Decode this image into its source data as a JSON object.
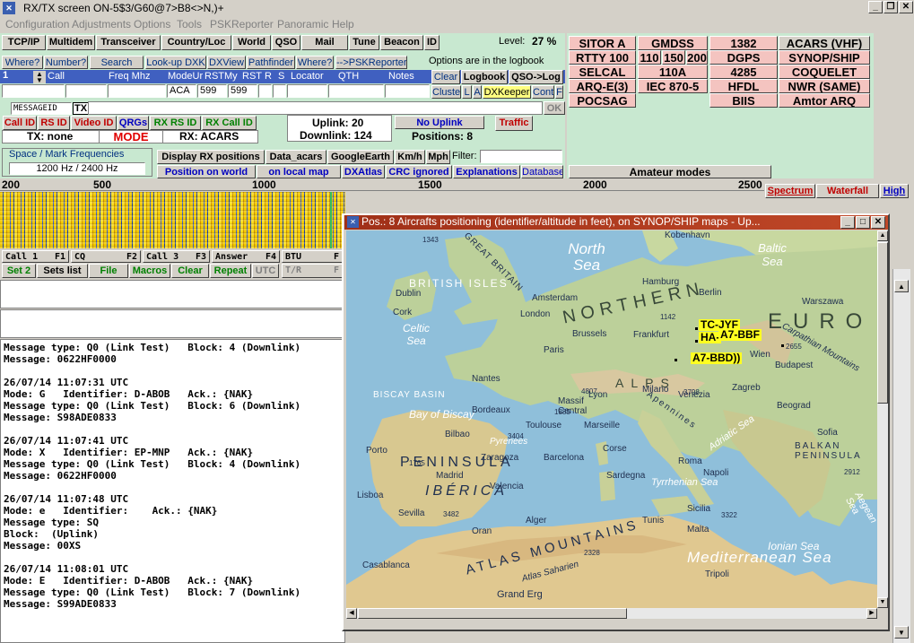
{
  "window": {
    "title": "RX/TX screen  ON-5$3/G60@7>B8<>N,)+"
  },
  "menu": [
    "Configuration",
    "Adjustments",
    "Options",
    "Tools",
    "PSKReporter",
    "Panoramic",
    "Help"
  ],
  "toolbar": {
    "tcpip": "TCP/IP",
    "multidem": "Multidem",
    "transceiver": "Transceiver",
    "country": "Country/Loc",
    "world": "World",
    "qso": "QSO",
    "mail": "Mail",
    "tune": "Tune",
    "beacon": "Beacon",
    "id": "ID",
    "level_label": "Level:",
    "level_value": "27 %"
  },
  "row2": {
    "where1": "Where?",
    "number": "Number?",
    "search": "Search",
    "lookup": "Look-up DXK",
    "dxview": "DXView",
    "pathfinder": "Pathfinder",
    "where2": "Where?",
    "pskrep": "-->PSKReporter",
    "logbook_note": "Options are in the logbook"
  },
  "log_headers": {
    "call": "Call",
    "freq": "Freq Mhz",
    "mode": "ModeUr",
    "rst": "RSTMy",
    "rst2": "RST",
    "r": "R",
    "s": "S",
    "locator": "Locator",
    "qth": "QTH",
    "notes": "Notes"
  },
  "log_row": {
    "num": "1",
    "mode": "ACA",
    "rst": "599",
    "rst2": "599"
  },
  "log_buttons": {
    "clear": "Clear",
    "logbook": "Logbook",
    "qsolog": "QSO->Log",
    "cluster": "Cluster",
    "l": "L",
    "a": "A",
    "dxkeeper": "DXKeeper",
    "cont": "Cont",
    "f": "F"
  },
  "msgid": "MESSAGEID",
  "tx_badge": "TX",
  "ok": "OK",
  "idbar": {
    "call_id": "Call ID",
    "rs_id": "RS ID",
    "video_id": "Video ID",
    "qrgs": "QRGs",
    "rx_rs_id": "RX RS ID",
    "rx_call_id": "RX Call ID"
  },
  "status": {
    "tx": "TX: none",
    "mode": "MODE",
    "rx": "RX: ACARS",
    "uplink": "Uplink: 20",
    "downlink": "Downlink: 124",
    "no_uplink": "No Uplink",
    "positions": "Positions: 8",
    "traffic": "Traffic"
  },
  "spacemark": {
    "title": "Space / Mark Frequencies",
    "value": "1200 Hz / 2400 Hz"
  },
  "display": {
    "rxpos": "Display RX positions",
    "data_acars": "Data_acars",
    "google": "GoogleEarth",
    "kmh": "Km/h",
    "mph": "Mph",
    "filter_label": "Filter:",
    "posworld": "Position on world",
    "localmap": "on local map",
    "dxatlas": "DXAtlas",
    "crc": "CRC ignored",
    "explanations": "Explanations",
    "database": "Database"
  },
  "modes": [
    [
      "SITOR A",
      "GMDSS",
      "1382",
      "ACARS (VHF)"
    ],
    [
      "RTTY 100",
      "110",
      "150",
      "200",
      "DGPS",
      "SYNOP/SHIP"
    ],
    [
      "SELCAL",
      "110A",
      "4285",
      "COQUELET"
    ],
    [
      "ARQ-E(3)",
      "IEC 870-5",
      "HFDL",
      "NWR (SAME)"
    ],
    [
      "POCSAG",
      "BIIS",
      "Amtor ARQ"
    ]
  ],
  "amateur": "Amateur modes",
  "ruler": {
    "ticks": [
      "200",
      "500",
      "1000",
      "1500",
      "2000",
      "2500"
    ],
    "spectrum": "Spectrum",
    "waterfall": "Waterfall",
    "high": "High"
  },
  "macros": {
    "call1": "Call 1",
    "f1": "F1",
    "cq": "CQ",
    "f2": "F2",
    "call3": "Call 3",
    "f3": "F3",
    "answer": "Answer",
    "f4": "F4",
    "btu": "BTU",
    "f5": "F",
    "set2": "Set 2",
    "setslist": "Sets list",
    "file": "File",
    "macros": "Macros",
    "clear": "Clear",
    "repeat": "Repeat",
    "utc": "UTC",
    "tr": "T/R",
    "f6": "F"
  },
  "log_text": [
    "Message type: Q0 (Link Test)   Block: 4 (Downlink)",
    "Message: 0622HF0000",
    "",
    "26/07/14 11:07:31 UTC",
    "Mode: G   Identifier: D-ABOB   Ack.: {NAK}",
    "Message type: Q0 (Link Test)   Block: 6 (Downlink)",
    "Message: S98ADE0833",
    "",
    "26/07/14 11:07:41 UTC",
    "Mode: X   Identifier: EP-MNP   Ack.: {NAK}",
    "Message type: Q0 (Link Test)   Block: 4 (Downlink)",
    "Message: 0622HF0000",
    "",
    "26/07/14 11:07:48 UTC",
    "Mode: e   Identifier:    Ack.: {NAK}",
    "Message type: SQ",
    "Block:  (Uplink)",
    "Message: 00XS",
    "",
    "26/07/14 11:08:01 UTC",
    "Mode: E   Identifier: D-ABOB   Ack.: {NAK}",
    "Message type: Q0 (Link Test)   Block: 7 (Downlink)",
    "Message: S99ADE0833"
  ],
  "map": {
    "title": "Pos.: 8   Aircrafts positioning (identifier/altitude in feet), on SYNOP/SHIP maps - Up...",
    "aircraft": [
      "TC-JYF",
      "HA-",
      "A7-BBF",
      "A7-BBD"
    ],
    "seas": [
      "North Sea",
      "Baltic Sea",
      "Celtic Sea",
      "BISCAY BASIN",
      "Bay of Biscay",
      "Adriatic Sea",
      "Tyrrhenian Sea",
      "Ionian Sea",
      "Mediterranean Sea",
      "Aegean Sea"
    ],
    "regions": [
      "GREAT BRITAIN",
      "BRITISH ISLES",
      "NORTHERN",
      "EURO",
      "PENINSULA",
      "IBÉRICA",
      "ATLAS MOUNTAINS",
      "ALPS",
      "Massif Central",
      "Pyrenees",
      "Apennines",
      "Carpathian Mountains",
      "BALKAN PENINSULA",
      "Grand Erg",
      "Atlas Saharien"
    ],
    "cities": [
      "Dublin",
      "London",
      "Amsterdam",
      "Hamburg",
      "Berlin",
      "Warszawa",
      "Brussels",
      "Frankfurt",
      "Paris",
      "Wien",
      "Budapest",
      "Bordeaux",
      "Lyon",
      "Milano",
      "Barcelona",
      "Roma",
      "Madrid",
      "Napoli",
      "Lisboa",
      "Sevilla",
      "Alger",
      "Tunis",
      "Casablanca",
      "Beograd",
      "Sofia",
      "Kobenhavn",
      "Corse",
      "Sardegna",
      "Sicilia",
      "Malta",
      "Cork",
      "Nantes",
      "Porto",
      "Bilbao",
      "Zaragoza",
      "Valencia",
      "Marseille",
      "Toulouse",
      "Venezia",
      "Zagreb",
      "Oran",
      "Tripoli"
    ],
    "peaks": [
      "1343",
      "1142",
      "2655",
      "4807",
      "1885",
      "3798",
      "3404",
      "1765",
      "3482",
      "2328",
      "2912",
      "3322"
    ]
  }
}
